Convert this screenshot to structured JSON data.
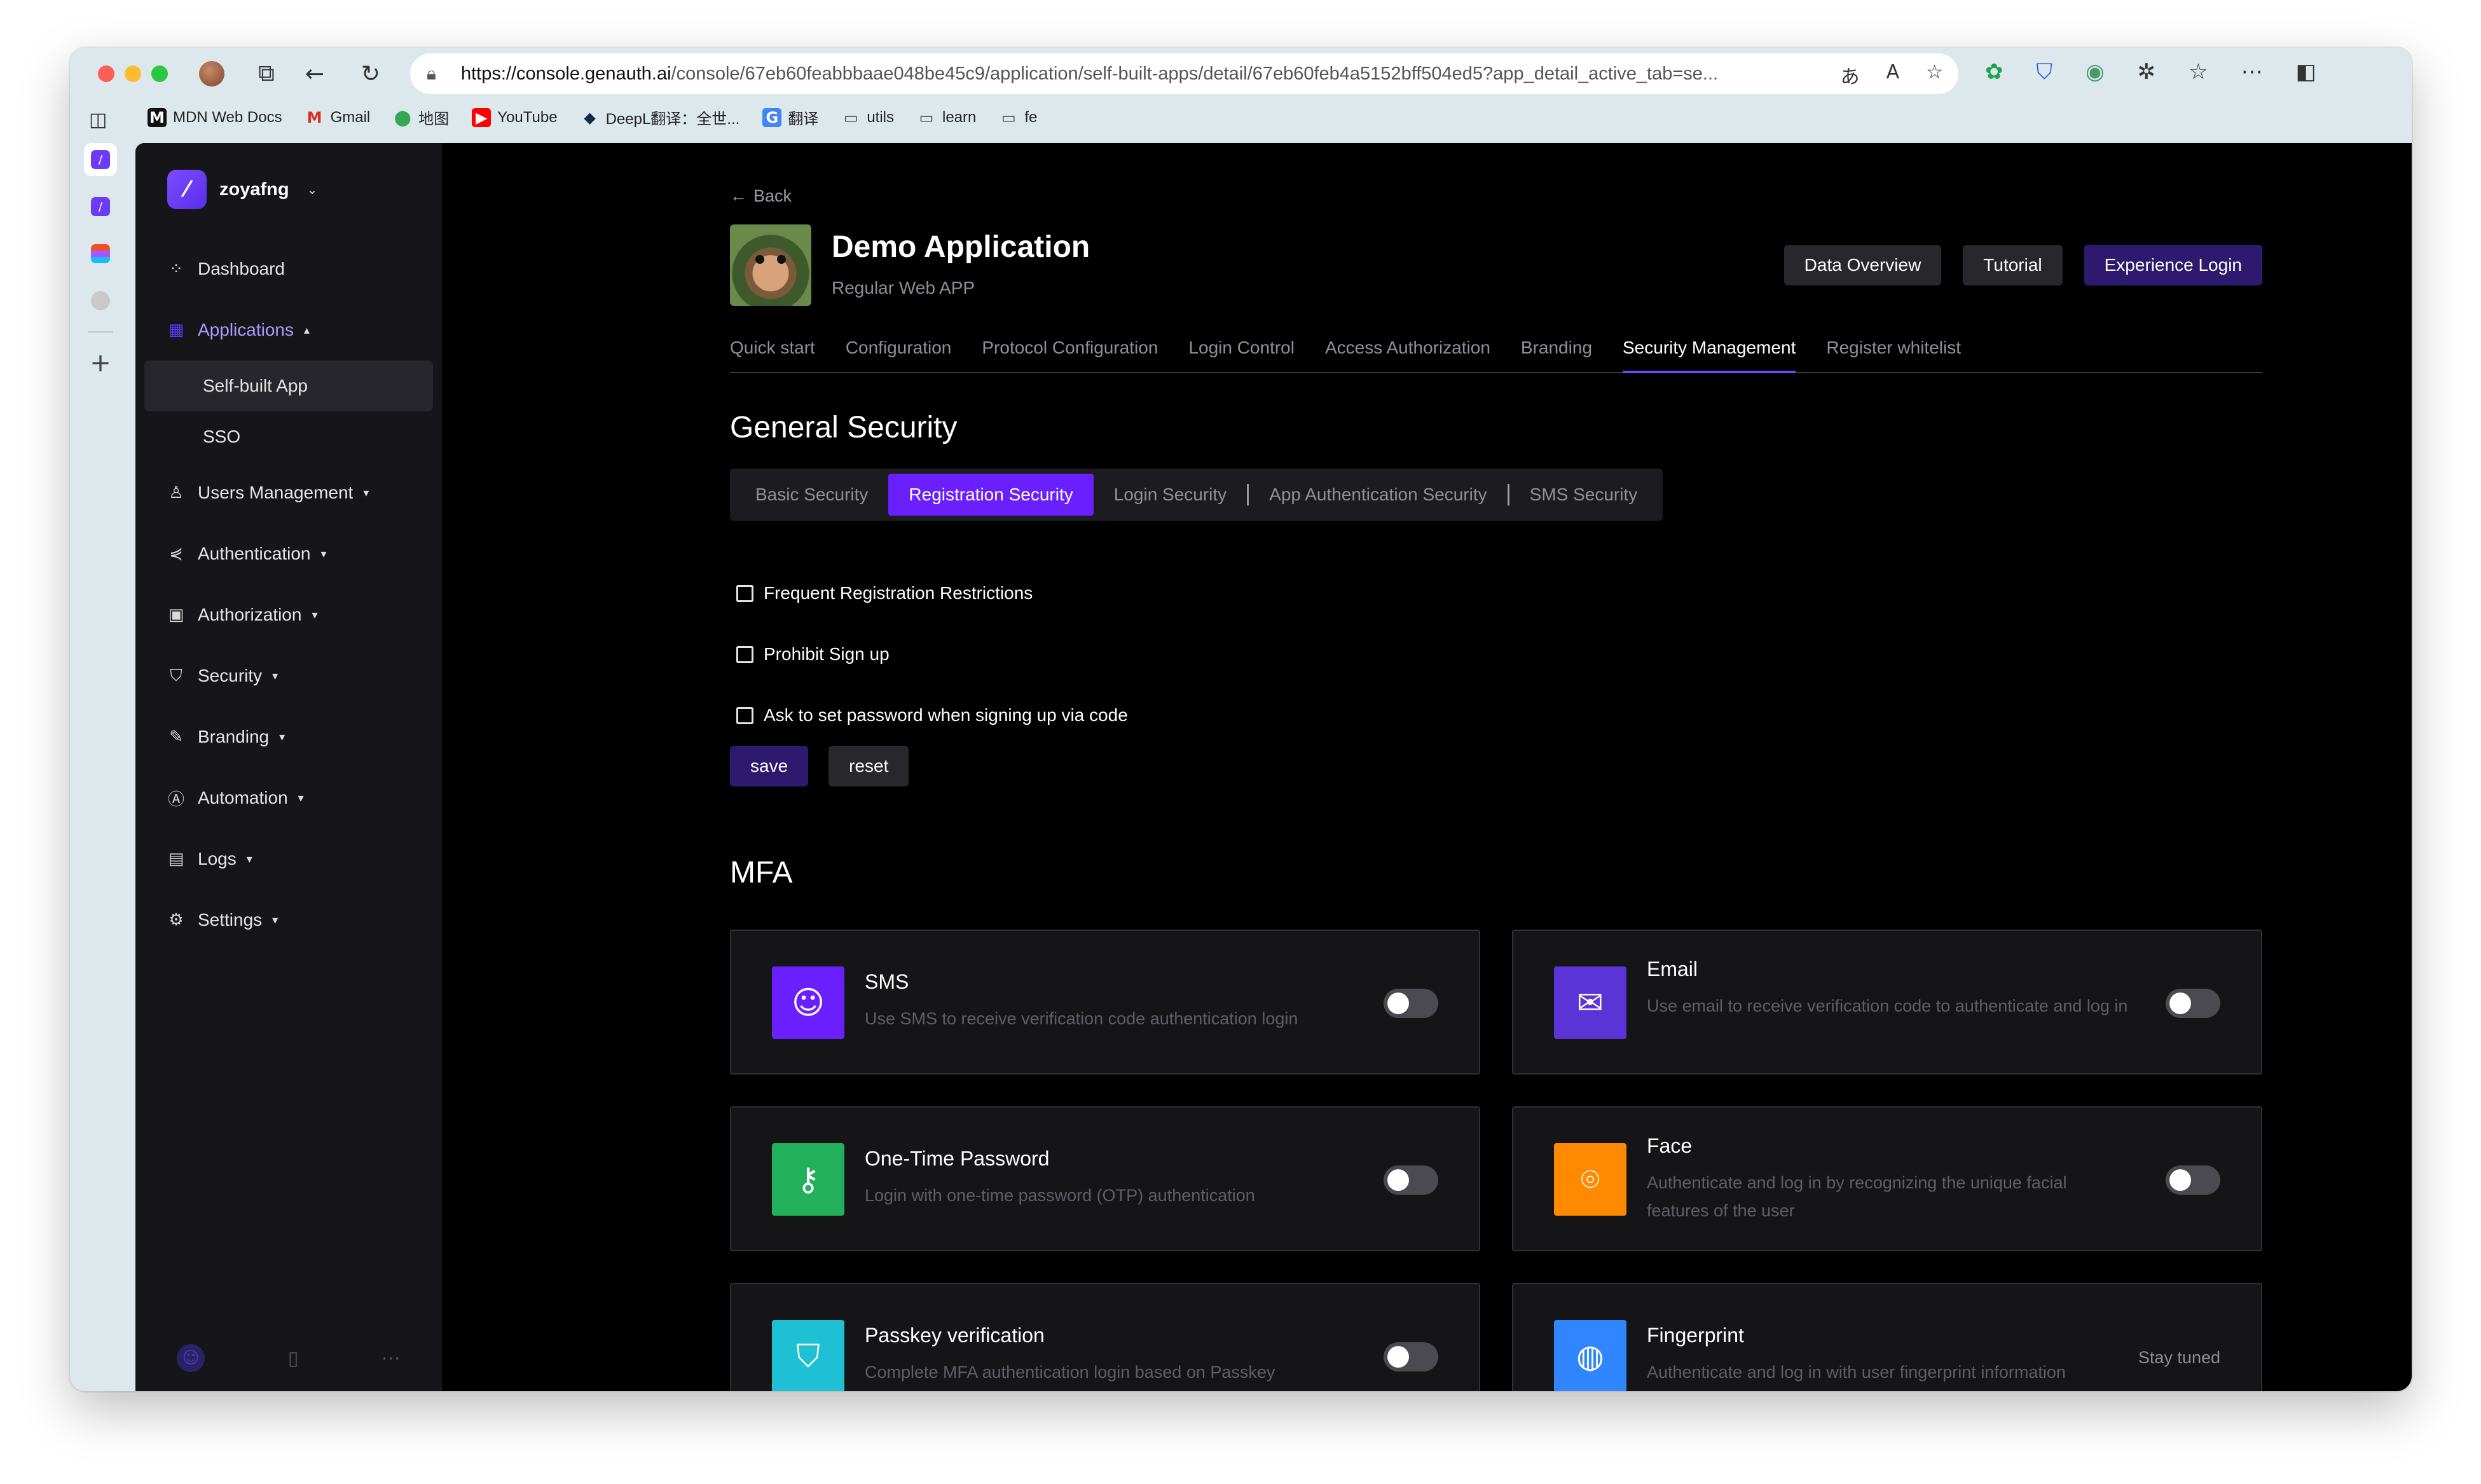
{
  "browser": {
    "url_host": "https://console.genauth.ai",
    "url_path": "/console/67eb60feabbbaae048be45c9/application/self-built-apps/detail/67eb60feb4a5152bff504ed5?app_detail_active_tab=se..."
  },
  "bookmarks": [
    {
      "label": "MDN Web Docs",
      "icon": "M",
      "icon_bg": "#111111",
      "icon_fg": "#ffffff"
    },
    {
      "label": "Gmail",
      "icon": "M",
      "icon_bg": "transparent",
      "icon_fg": "#d93025"
    },
    {
      "label": "地图",
      "icon": "⬤",
      "icon_bg": "transparent",
      "icon_fg": "#34a853"
    },
    {
      "label": "YouTube",
      "icon": "▶",
      "icon_bg": "#ff0000",
      "icon_fg": "#ffffff"
    },
    {
      "label": "DeepL翻译：全世...",
      "icon": "◆",
      "icon_bg": "transparent",
      "icon_fg": "#0f2b46"
    },
    {
      "label": "翻译",
      "icon": "G",
      "icon_bg": "#4285f4",
      "icon_fg": "#ffffff"
    },
    {
      "label": "utils",
      "icon": "▭",
      "icon_bg": "transparent",
      "icon_fg": "#333333"
    },
    {
      "label": "learn",
      "icon": "▭",
      "icon_bg": "transparent",
      "icon_fg": "#333333"
    },
    {
      "label": "fe",
      "icon": "▭",
      "icon_bg": "transparent",
      "icon_fg": "#333333"
    }
  ],
  "sidebar": {
    "org_name": "zoyafng",
    "items": [
      {
        "label": "Dashboard",
        "icon": "dashboard-icon",
        "glyph": "⁘"
      },
      {
        "label": "Applications",
        "icon": "applications-icon",
        "glyph": "▦",
        "caret": "▴"
      },
      {
        "label": "Users Management",
        "icon": "user-icon",
        "glyph": "♙",
        "caret": "▾"
      },
      {
        "label": "Authentication",
        "icon": "share-icon",
        "glyph": "⋞",
        "caret": "▾"
      },
      {
        "label": "Authorization",
        "icon": "lock-icon",
        "glyph": "▣",
        "caret": "▾"
      },
      {
        "label": "Security",
        "icon": "shield-icon",
        "glyph": "⛉",
        "caret": "▾"
      },
      {
        "label": "Branding",
        "icon": "brush-icon",
        "glyph": "✎",
        "caret": "▾"
      },
      {
        "label": "Automation",
        "icon": "automation-icon",
        "glyph": "Ⓐ",
        "caret": "▾"
      },
      {
        "label": "Logs",
        "icon": "logs-icon",
        "glyph": "▤",
        "caret": "▾"
      },
      {
        "label": "Settings",
        "icon": "gear-icon",
        "glyph": "⚙",
        "caret": "▾"
      }
    ],
    "sub_items": [
      "Self-built App",
      "SSO"
    ]
  },
  "header": {
    "back_label": "Back",
    "app_title": "Demo Application",
    "app_subtitle": "Regular Web APP",
    "buttons": [
      "Data Overview",
      "Tutorial",
      "Experience Login"
    ]
  },
  "tabs": [
    "Quick start",
    "Configuration",
    "Protocol Configuration",
    "Login Control",
    "Access Authorization",
    "Branding",
    "Security Management",
    "Register whitelist"
  ],
  "general_security": {
    "title": "General Security",
    "segments": [
      "Basic Security",
      "Registration Security",
      "Login Security",
      "App Authentication Security",
      "SMS Security"
    ],
    "checkboxes": [
      "Frequent Registration Restrictions",
      "Prohibit Sign up",
      "Ask to set password when signing up via code"
    ],
    "save_label": "save",
    "reset_label": "reset"
  },
  "mfa": {
    "title": "MFA",
    "cards": [
      {
        "title": "SMS",
        "desc": "Use SMS to receive verification code authentication login",
        "icon": "sms-icon",
        "glyph": "☺",
        "color": "#6a1fff",
        "enabled": false
      },
      {
        "title": "Email",
        "desc": "Use email to receive verification code to authenticate and log in",
        "icon": "email-icon",
        "glyph": "✉",
        "color": "#5b34d8",
        "enabled": false
      },
      {
        "title": "One-Time Password",
        "desc": "Login with one-time password (OTP) authentication",
        "icon": "key-icon",
        "glyph": "⚷",
        "color": "#22b05b",
        "enabled": false
      },
      {
        "title": "Face",
        "desc": "Authenticate and log in by recognizing the unique facial features of the user",
        "icon": "face-scan-icon",
        "glyph": "⌾",
        "color": "#ff8a00",
        "enabled": false
      },
      {
        "title": "Passkey verification",
        "desc": "Complete MFA authentication login based on Passkey",
        "icon": "passkey-shield-icon",
        "glyph": "⛉",
        "color": "#1fc0d4",
        "enabled": false
      },
      {
        "title": "Fingerprint",
        "desc": "Authenticate and log in with user fingerprint information",
        "icon": "fingerprint-icon",
        "glyph": "◍",
        "color": "#2f86ff",
        "status": "Stay tuned"
      }
    ]
  }
}
